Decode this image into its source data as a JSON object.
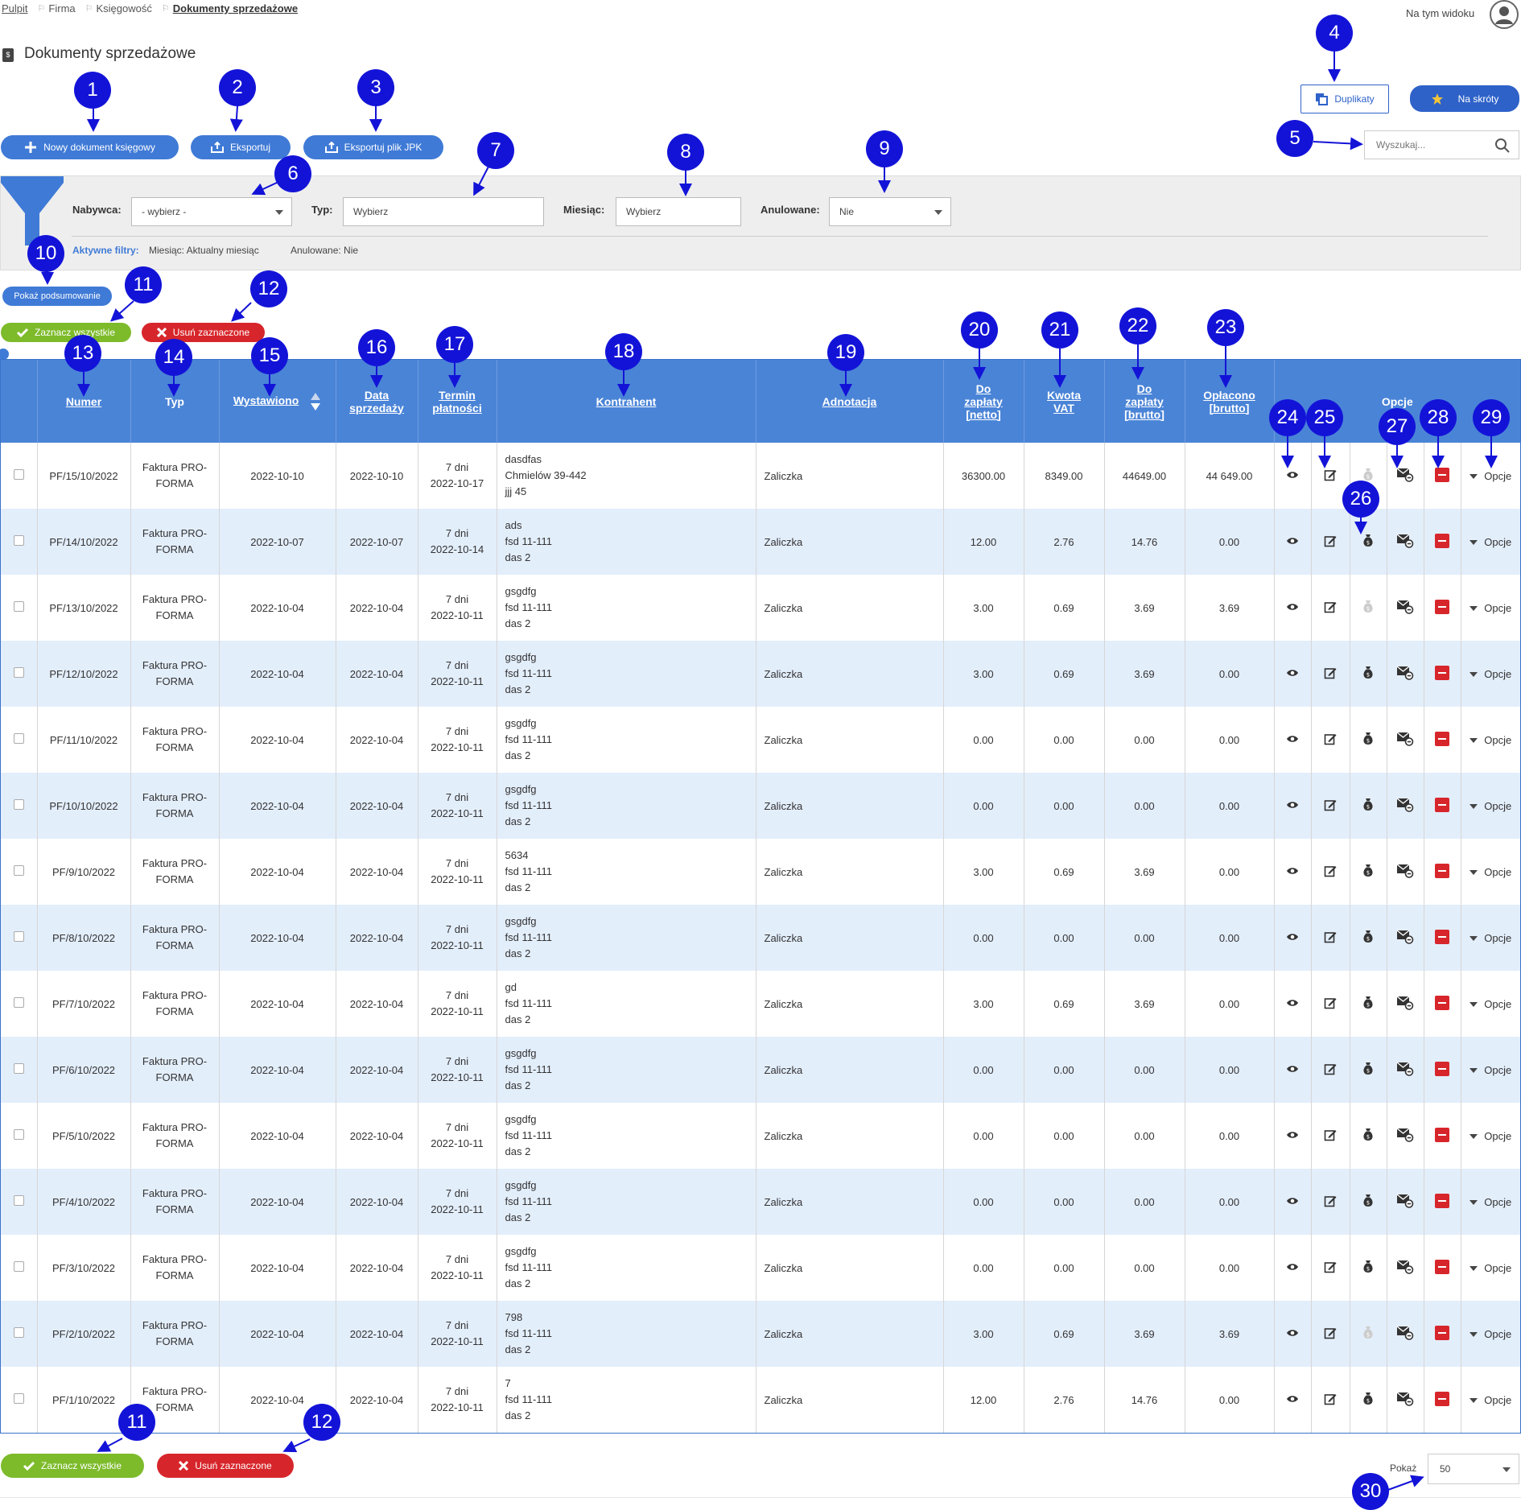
{
  "breadcrumb": {
    "items": [
      "Pulpit",
      "Firma",
      "Księgowość"
    ],
    "current": "Dokumenty sprzedażowe"
  },
  "header": {
    "view_label": "Na tym widoku",
    "title": "Dokumenty sprzedażowe"
  },
  "toolbar": {
    "new_doc": "Nowy dokument księgowy",
    "export": "Eksportuj",
    "export_jpk": "Eksportuj plik JPK",
    "duplicates": "Duplikaty",
    "shortcuts": "Na skróty",
    "search_placeholder": "Wyszukaj..."
  },
  "filters": {
    "buyer_label": "Nabywca:",
    "buyer_value": "- wybierz -",
    "type_label": "Typ:",
    "type_value": "Wybierz",
    "month_label": "Miesiąc:",
    "month_value": "Wybierz",
    "cancelled_label": "Anulowane:",
    "cancelled_value": "Nie",
    "active_label": "Aktywne filtry:",
    "active_month": "Miesiąc: Aktualny miesiąc",
    "active_cancelled": "Anulowane: Nie"
  },
  "summary_btn": "Pokaż podsumowanie",
  "select_all": "Zaznacz wszystkie",
  "delete_selected": "Usuń zaznaczone",
  "table": {
    "headers": {
      "numer": "Numer",
      "typ": "Typ",
      "wystawiono": "Wystawiono",
      "data_sprzedazy_1": "Data",
      "data_sprzedazy_2": "sprzedaży",
      "termin_1": "Termin",
      "termin_2": "płatności",
      "kontrahent": "Kontrahent",
      "adnotacja": "Adnotacja",
      "netto_1": "Do",
      "netto_2": "zapłaty",
      "netto_3": "[netto]",
      "vat_1": "Kwota",
      "vat_2": "VAT",
      "brutto_1": "Do",
      "brutto_2": "zapłaty",
      "brutto_3": "[brutto]",
      "oplacono_1": "Opłacono",
      "oplacono_2": "[brutto]",
      "opcje": "Opcje"
    },
    "type_line1": "Faktura PRO-",
    "type_line2": "FORMA",
    "options_label": "Opcje",
    "rows": [
      {
        "numer": "PF/15/10/2022",
        "wyst": "2022-10-10",
        "sprz": "2022-10-10",
        "term1": "7 dni",
        "term2": "2022-10-17",
        "k1": "dasdfas",
        "k2": "Chmielów 39-442",
        "k3": "jjj 45",
        "adn": "Zaliczka",
        "netto": "36300.00",
        "vat": "8349.00",
        "brutto": "44649.00",
        "opl": "44 649.00",
        "paid_icon": "faded"
      },
      {
        "numer": "PF/14/10/2022",
        "wyst": "2022-10-07",
        "sprz": "2022-10-07",
        "term1": "7 dni",
        "term2": "2022-10-14",
        "k1": "ads",
        "k2": "fsd 11-111",
        "k3": "das 2",
        "adn": "Zaliczka",
        "netto": "12.00",
        "vat": "2.76",
        "brutto": "14.76",
        "opl": "0.00",
        "paid_icon": "active"
      },
      {
        "numer": "PF/13/10/2022",
        "wyst": "2022-10-04",
        "sprz": "2022-10-04",
        "term1": "7 dni",
        "term2": "2022-10-11",
        "k1": "gsgdfg",
        "k2": "fsd 11-111",
        "k3": "das 2",
        "adn": "Zaliczka",
        "netto": "3.00",
        "vat": "0.69",
        "brutto": "3.69",
        "opl": "3.69",
        "paid_icon": "faded"
      },
      {
        "numer": "PF/12/10/2022",
        "wyst": "2022-10-04",
        "sprz": "2022-10-04",
        "term1": "7 dni",
        "term2": "2022-10-11",
        "k1": "gsgdfg",
        "k2": "fsd 11-111",
        "k3": "das 2",
        "adn": "Zaliczka",
        "netto": "3.00",
        "vat": "0.69",
        "brutto": "3.69",
        "opl": "0.00",
        "paid_icon": "active"
      },
      {
        "numer": "PF/11/10/2022",
        "wyst": "2022-10-04",
        "sprz": "2022-10-04",
        "term1": "7 dni",
        "term2": "2022-10-11",
        "k1": "gsgdfg",
        "k2": "fsd 11-111",
        "k3": "das 2",
        "adn": "Zaliczka",
        "netto": "0.00",
        "vat": "0.00",
        "brutto": "0.00",
        "opl": "0.00",
        "paid_icon": "active"
      },
      {
        "numer": "PF/10/10/2022",
        "wyst": "2022-10-04",
        "sprz": "2022-10-04",
        "term1": "7 dni",
        "term2": "2022-10-11",
        "k1": "gsgdfg",
        "k2": "fsd 11-111",
        "k3": "das 2",
        "adn": "Zaliczka",
        "netto": "0.00",
        "vat": "0.00",
        "brutto": "0.00",
        "opl": "0.00",
        "paid_icon": "active"
      },
      {
        "numer": "PF/9/10/2022",
        "wyst": "2022-10-04",
        "sprz": "2022-10-04",
        "term1": "7 dni",
        "term2": "2022-10-11",
        "k1": "5634",
        "k2": "fsd 11-111",
        "k3": "das 2",
        "adn": "Zaliczka",
        "netto": "3.00",
        "vat": "0.69",
        "brutto": "3.69",
        "opl": "0.00",
        "paid_icon": "active"
      },
      {
        "numer": "PF/8/10/2022",
        "wyst": "2022-10-04",
        "sprz": "2022-10-04",
        "term1": "7 dni",
        "term2": "2022-10-11",
        "k1": "gsgdfg",
        "k2": "fsd 11-111",
        "k3": "das 2",
        "adn": "Zaliczka",
        "netto": "0.00",
        "vat": "0.00",
        "brutto": "0.00",
        "opl": "0.00",
        "paid_icon": "active"
      },
      {
        "numer": "PF/7/10/2022",
        "wyst": "2022-10-04",
        "sprz": "2022-10-04",
        "term1": "7 dni",
        "term2": "2022-10-11",
        "k1": "gd",
        "k2": "fsd 11-111",
        "k3": "das 2",
        "adn": "Zaliczka",
        "netto": "3.00",
        "vat": "0.69",
        "brutto": "3.69",
        "opl": "0.00",
        "paid_icon": "active"
      },
      {
        "numer": "PF/6/10/2022",
        "wyst": "2022-10-04",
        "sprz": "2022-10-04",
        "term1": "7 dni",
        "term2": "2022-10-11",
        "k1": "gsgdfg",
        "k2": "fsd 11-111",
        "k3": "das 2",
        "adn": "Zaliczka",
        "netto": "0.00",
        "vat": "0.00",
        "brutto": "0.00",
        "opl": "0.00",
        "paid_icon": "active"
      },
      {
        "numer": "PF/5/10/2022",
        "wyst": "2022-10-04",
        "sprz": "2022-10-04",
        "term1": "7 dni",
        "term2": "2022-10-11",
        "k1": "gsgdfg",
        "k2": "fsd 11-111",
        "k3": "das 2",
        "adn": "Zaliczka",
        "netto": "0.00",
        "vat": "0.00",
        "brutto": "0.00",
        "opl": "0.00",
        "paid_icon": "active"
      },
      {
        "numer": "PF/4/10/2022",
        "wyst": "2022-10-04",
        "sprz": "2022-10-04",
        "term1": "7 dni",
        "term2": "2022-10-11",
        "k1": "gsgdfg",
        "k2": "fsd 11-111",
        "k3": "das 2",
        "adn": "Zaliczka",
        "netto": "0.00",
        "vat": "0.00",
        "brutto": "0.00",
        "opl": "0.00",
        "paid_icon": "active"
      },
      {
        "numer": "PF/3/10/2022",
        "wyst": "2022-10-04",
        "sprz": "2022-10-04",
        "term1": "7 dni",
        "term2": "2022-10-11",
        "k1": "gsgdfg",
        "k2": "fsd 11-111",
        "k3": "das 2",
        "adn": "Zaliczka",
        "netto": "0.00",
        "vat": "0.00",
        "brutto": "0.00",
        "opl": "0.00",
        "paid_icon": "active"
      },
      {
        "numer": "PF/2/10/2022",
        "wyst": "2022-10-04",
        "sprz": "2022-10-04",
        "term1": "7 dni",
        "term2": "2022-10-11",
        "k1": "798",
        "k2": "fsd 11-111",
        "k3": "das 2",
        "adn": "Zaliczka",
        "netto": "3.00",
        "vat": "0.69",
        "brutto": "3.69",
        "opl": "3.69",
        "paid_icon": "faded"
      },
      {
        "numer": "PF/1/10/2022",
        "wyst": "2022-10-04",
        "sprz": "2022-10-04",
        "term1": "7 dni",
        "term2": "2022-10-11",
        "k1": "7",
        "k2": "fsd 11-111",
        "k3": "das 2",
        "adn": "Zaliczka",
        "netto": "12.00",
        "vat": "2.76",
        "brutto": "14.76",
        "opl": "0.00",
        "paid_icon": "active"
      }
    ]
  },
  "pager": {
    "label": "Pokaż",
    "value": "50"
  },
  "markers": [
    "1",
    "2",
    "3",
    "4",
    "5",
    "6",
    "7",
    "8",
    "9",
    "10",
    "11",
    "12",
    "13",
    "14",
    "15",
    "16",
    "17",
    "18",
    "19",
    "20",
    "21",
    "22",
    "23",
    "24",
    "25",
    "26",
    "27",
    "28",
    "29",
    "11",
    "12",
    "30"
  ],
  "colors": {
    "primary": "#3f7ad6",
    "header": "#4a84d7",
    "success": "#7dbb2b",
    "danger": "#d7262b",
    "marker": "#1313d8"
  }
}
